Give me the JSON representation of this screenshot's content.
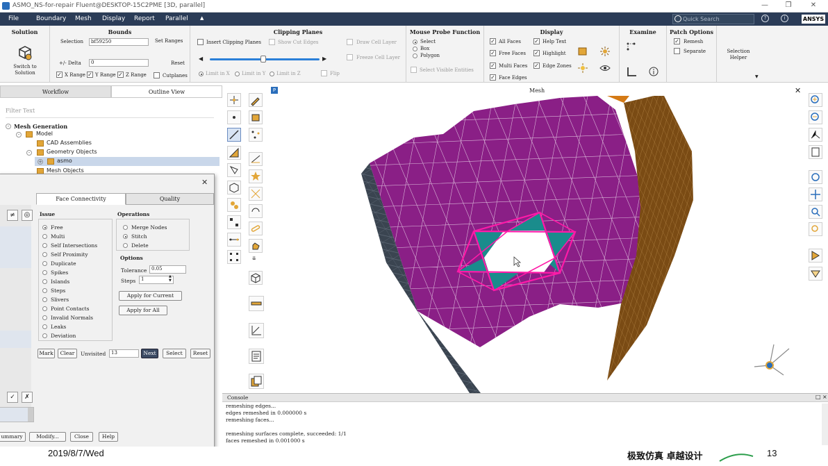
{
  "window": {
    "title": "ASMO_NS-for-repair Fluent@DESKTOP-15C2PME  [3D, parallel]"
  },
  "menu": {
    "items": [
      "File",
      "Boundary",
      "Mesh",
      "Display",
      "Report",
      "Parallel"
    ],
    "search_placeholder": "Quick Search",
    "brand": "ANSYS"
  },
  "ribbon": {
    "solution": {
      "header": "Solution",
      "button": "Switch to Solution"
    },
    "bounds": {
      "header": "Bounds",
      "selection_label": "Selection",
      "selection_value": "bf59250",
      "set_ranges": "Set Ranges",
      "delta_label": "+/- Delta",
      "delta_value": "0",
      "reset": "Reset",
      "x_range": "X Range",
      "y_range": "Y Range",
      "z_range": "Z Range",
      "cutplanes": "Cutplanes"
    },
    "clipping": {
      "header": "Clipping Planes",
      "insert": "Insert Clipping Planes",
      "show_cut_edges": "Show Cut Edges",
      "draw_cell_layer": "Draw Cell Layer",
      "freeze_cell_layer": "Freeze Cell Layer",
      "limit_x": "Limit in X",
      "limit_y": "Limit in Y",
      "limit_z": "Limit in Z",
      "flip": "Flip"
    },
    "probe": {
      "header": "Mouse Probe Function",
      "select": "Select",
      "box": "Box",
      "polygon": "Polygon",
      "select_visible": "Select Visible Entities"
    },
    "display": {
      "header": "Display",
      "all_faces": "All Faces",
      "free_faces": "Free Faces",
      "multi_faces": "Multi Faces",
      "face_edges": "Face Edges",
      "help_text": "Help Text",
      "highlight": "Highlight",
      "edge_zones": "Edge Zones"
    },
    "examine": {
      "header": "Examine"
    },
    "patch": {
      "header": "Patch Options",
      "remesh": "Remesh",
      "separate": "Separate"
    },
    "selection_helper": "Selection Helper"
  },
  "left": {
    "tabs": [
      "Workflow",
      "Outline View"
    ],
    "filter_placeholder": "Filter Text",
    "tree": [
      "Mesh Generation",
      "Model",
      "CAD Assemblies",
      "Geometry Objects",
      "asmo",
      "Mesh Objects"
    ]
  },
  "dialog": {
    "tabs": [
      "Face Connectivity",
      "Quality"
    ],
    "issue_header": "Issue",
    "issues": [
      "Free",
      "Multi",
      "Self Intersections",
      "Self Proximity",
      "Duplicate",
      "Spikes",
      "Islands",
      "Steps",
      "Slivers",
      "Point Contacts",
      "Invalid Normals",
      "Leaks",
      "Deviation"
    ],
    "operations_header": "Operations",
    "operations": [
      "Merge Nodes",
      "Stitch",
      "Delete"
    ],
    "options_header": "Options",
    "tolerance_label": "Tolerance",
    "tolerance_value": "0.05",
    "steps_label": "Steps",
    "steps_value": "1",
    "apply_current": "Apply for Current",
    "apply_all": "Apply for All",
    "mark": "Mark",
    "clear": "Clear",
    "unvisited_label": "Unvisited",
    "unvisited_value": "13",
    "next": "Next",
    "select": "Select",
    "reset": "Reset",
    "bottom_buttons": [
      "ummary",
      "Modify...",
      "Close",
      "Help"
    ]
  },
  "graphics": {
    "title": "Mesh"
  },
  "console": {
    "title": "Console",
    "lines": [
      "remeshing edges...",
      "edges remeshed in 0.000000 s",
      "remeshing faces...",
      "",
      "remeshing surfaces complete, succeeded: 1/1",
      "faces remeshed in 0.001000 s"
    ]
  },
  "footer": {
    "date": "2019/8/7/Wed",
    "slogan": "极致仿真 卓越设计",
    "page": "13"
  },
  "colors": {
    "menubar": "#2b3c57",
    "purple_face": "#8a1f86",
    "teal_fill": "#1a8c8c",
    "pink_edge": "#ff1aa8",
    "brown_face": "#7a4b14",
    "dark_face": "#3a4450"
  }
}
